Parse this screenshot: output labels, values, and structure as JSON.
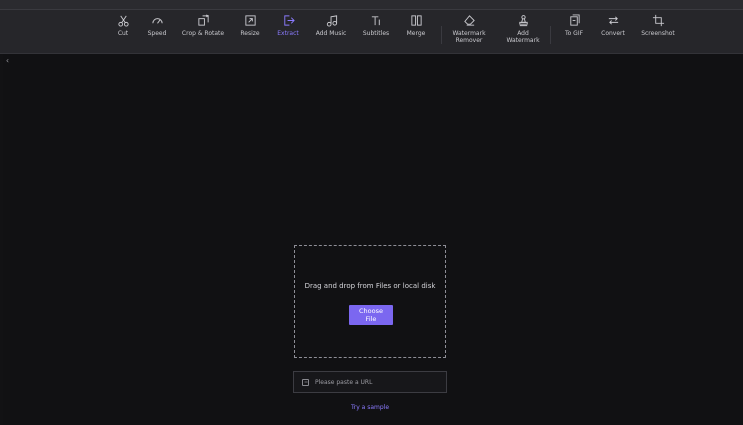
{
  "toolbar": {
    "items": [
      {
        "label": "Cut",
        "icon": "scissors-icon"
      },
      {
        "label": "Speed",
        "icon": "speedometer-icon"
      },
      {
        "label": "Crop & Rotate",
        "icon": "crop-rotate-icon"
      },
      {
        "label": "Resize",
        "icon": "resize-icon"
      },
      {
        "label": "Extract",
        "icon": "extract-icon"
      },
      {
        "label": "Add Music",
        "icon": "music-note-icon"
      },
      {
        "label": "Subtitles",
        "icon": "text-icon"
      },
      {
        "label": "Merge",
        "icon": "merge-icon"
      },
      {
        "label": "Watermark\nRemover",
        "icon": "eraser-icon"
      },
      {
        "label": "Add\nWatermark",
        "icon": "stamp-icon"
      },
      {
        "label": "To GIF",
        "icon": "gif-icon"
      },
      {
        "label": "Convert",
        "icon": "convert-arrows-icon"
      },
      {
        "label": "Screenshot",
        "icon": "crop-icon"
      }
    ],
    "active": "Extract",
    "accent_color": "#8b7bff"
  },
  "upload": {
    "drop_text": "Drag and drop from Files or local disk",
    "choose_label": "Choose File",
    "url_placeholder": "Please paste a URL",
    "try_sample_label": "Try a sample",
    "button_color": "#7b67f0"
  },
  "sidebar": {
    "collapse_icon": "chevron-left-icon"
  }
}
